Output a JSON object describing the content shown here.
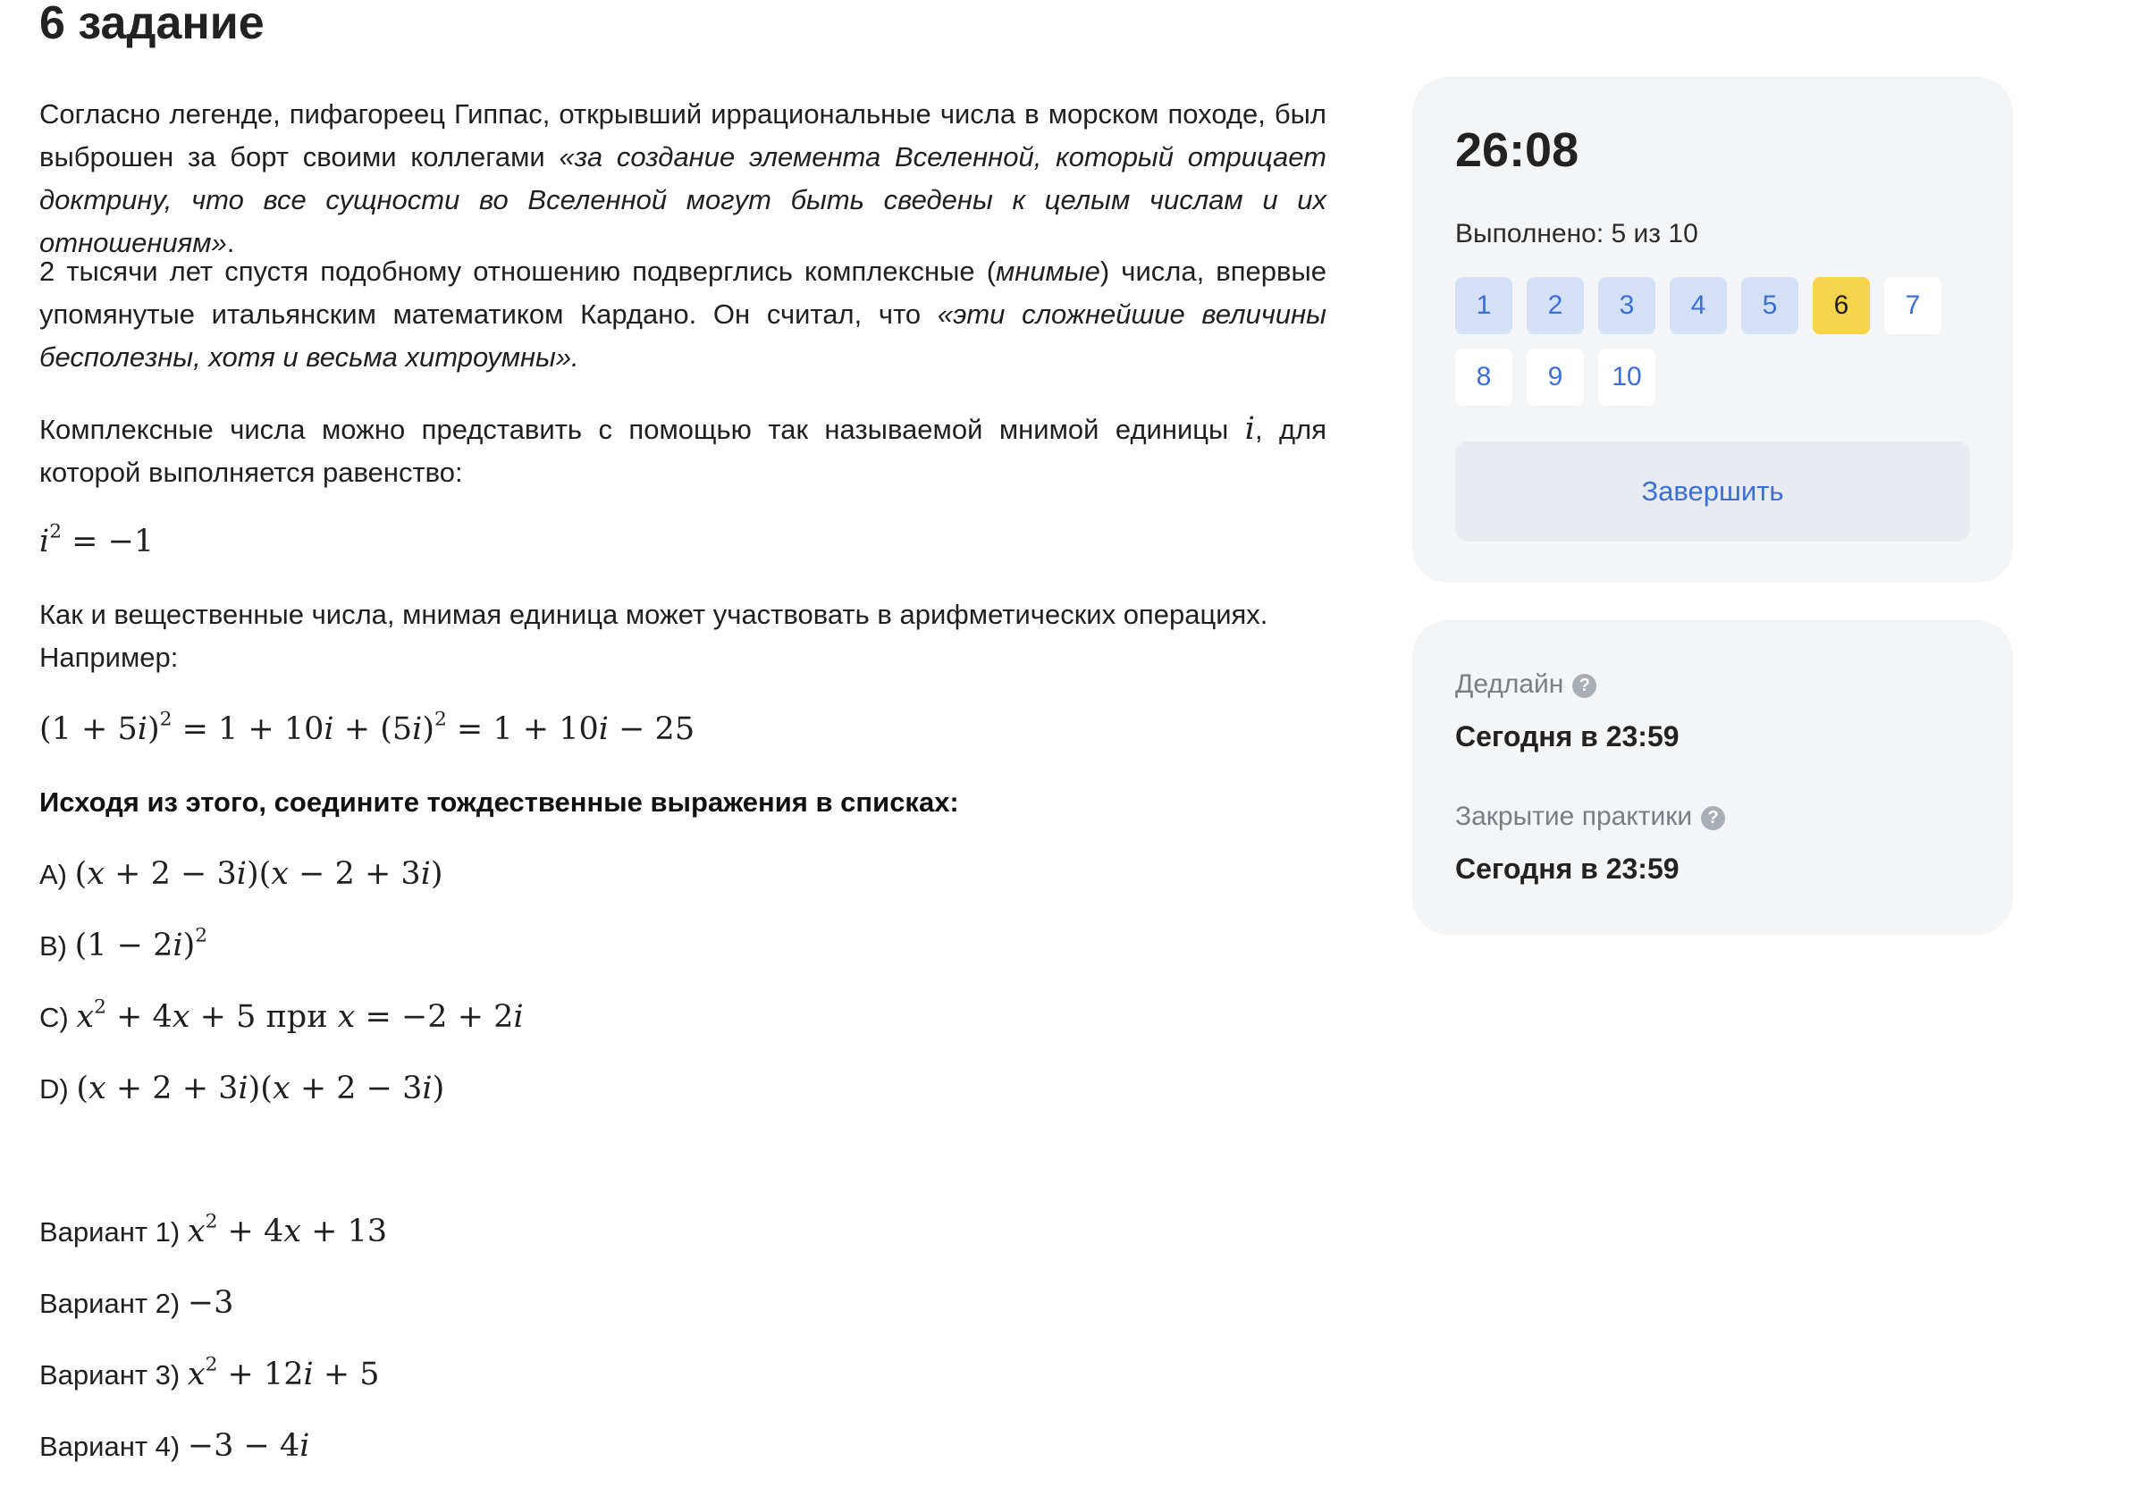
{
  "task": {
    "title": "6 задание",
    "intro1": [
      {
        "text": "Согласно легенде, пифагореец Гиппас, открывший иррациональные числа в морском походе, был выброшен за борт своими коллегами ",
        "style": "normal"
      },
      {
        "text": "«за создание элемента Вселенной, который отрицает доктрину, что все сущности во Вселенной могут быть сведены к целым числам и их отношениям»",
        "style": "italic"
      },
      {
        "text": ".",
        "style": "normal"
      }
    ],
    "intro2": [
      {
        "text": "2 тысячи лет спустя подобному отношению подверглись комплексные (",
        "style": "normal"
      },
      {
        "text": "мнимые",
        "style": "italic"
      },
      {
        "text": ") числа, впервые упомянутые итальянским математиком Кардано. Он считал, что ",
        "style": "normal"
      },
      {
        "text": "«эти сложнейшие величины бесполезны, хотя и весьма хитроумны».",
        "style": "italic"
      }
    ],
    "intro3": [
      {
        "text": "Комплексные числа можно представить с помощью так называемой мнимой единицы ",
        "style": "normal"
      },
      {
        "text": "i",
        "style": "mathvar"
      },
      {
        "text": ", для которой выполняется равенство:",
        "style": "normal"
      }
    ],
    "equation1": [
      {
        "text": "i",
        "style": "var"
      },
      {
        "text": "2",
        "style": "sup"
      },
      {
        "text": " = −1",
        "style": "normal"
      }
    ],
    "intro4": [
      {
        "text": "Как и вещественные числа, мнимая единица может участвовать в арифметических операциях.",
        "style": "normal"
      },
      {
        "text": "",
        "style": "br"
      },
      {
        "text": "Например:",
        "style": "normal"
      }
    ],
    "equation2": [
      {
        "text": "(1 + 5",
        "style": "normal"
      },
      {
        "text": "i",
        "style": "var"
      },
      {
        "text": ")",
        "style": "normal"
      },
      {
        "text": "2",
        "style": "sup"
      },
      {
        "text": " = 1 + 10",
        "style": "normal"
      },
      {
        "text": "i",
        "style": "var"
      },
      {
        "text": " + (5",
        "style": "normal"
      },
      {
        "text": "i",
        "style": "var"
      },
      {
        "text": ")",
        "style": "normal"
      },
      {
        "text": "2",
        "style": "sup"
      },
      {
        "text": " = 1 + 10",
        "style": "normal"
      },
      {
        "text": "i",
        "style": "var"
      },
      {
        "text": " − 25",
        "style": "normal"
      }
    ],
    "instruction": "Исходя из этого, соедините тождественные выражения в списках:",
    "left_items": [
      {
        "label": "A) ",
        "expr": [
          {
            "text": "(",
            "style": "normal"
          },
          {
            "text": "x",
            "style": "var"
          },
          {
            "text": " + 2 − 3",
            "style": "normal"
          },
          {
            "text": "i",
            "style": "var"
          },
          {
            "text": ")(",
            "style": "normal"
          },
          {
            "text": "x",
            "style": "var"
          },
          {
            "text": " − 2 + 3",
            "style": "normal"
          },
          {
            "text": "i",
            "style": "var"
          },
          {
            "text": ")",
            "style": "normal"
          }
        ]
      },
      {
        "label": "B) ",
        "expr": [
          {
            "text": "(1 − 2",
            "style": "normal"
          },
          {
            "text": "i",
            "style": "var"
          },
          {
            "text": ")",
            "style": "normal"
          },
          {
            "text": "2",
            "style": "sup"
          }
        ]
      },
      {
        "label": "C) ",
        "expr": [
          {
            "text": "x",
            "style": "var"
          },
          {
            "text": "2",
            "style": "sup"
          },
          {
            "text": " + 4",
            "style": "normal"
          },
          {
            "text": "x",
            "style": "var"
          },
          {
            "text": " + 5 при ",
            "style": "normal"
          },
          {
            "text": "x",
            "style": "var"
          },
          {
            "text": " = −2 + 2",
            "style": "normal"
          },
          {
            "text": "i",
            "style": "var"
          }
        ]
      },
      {
        "label": "D) ",
        "expr": [
          {
            "text": "(",
            "style": "normal"
          },
          {
            "text": "x",
            "style": "var"
          },
          {
            "text": " + 2 + 3",
            "style": "normal"
          },
          {
            "text": "i",
            "style": "var"
          },
          {
            "text": ")(",
            "style": "normal"
          },
          {
            "text": "x",
            "style": "var"
          },
          {
            "text": " + 2 − 3",
            "style": "normal"
          },
          {
            "text": "i",
            "style": "var"
          },
          {
            "text": ")",
            "style": "normal"
          }
        ]
      }
    ],
    "right_items": [
      {
        "label": "Вариант 1) ",
        "expr": [
          {
            "text": "x",
            "style": "var"
          },
          {
            "text": "2",
            "style": "sup"
          },
          {
            "text": " + 4",
            "style": "normal"
          },
          {
            "text": "x",
            "style": "var"
          },
          {
            "text": " + 13",
            "style": "normal"
          }
        ]
      },
      {
        "label": "Вариант 2) ",
        "expr": [
          {
            "text": "−3",
            "style": "normal"
          }
        ]
      },
      {
        "label": "Вариант 3) ",
        "expr": [
          {
            "text": "x",
            "style": "var"
          },
          {
            "text": "2",
            "style": "sup"
          },
          {
            "text": " + 12",
            "style": "normal"
          },
          {
            "text": "i",
            "style": "var"
          },
          {
            "text": " + 5",
            "style": "normal"
          }
        ]
      },
      {
        "label": "Вариант 4) ",
        "expr": [
          {
            "text": "−3 − 4",
            "style": "normal"
          },
          {
            "text": "i",
            "style": "var"
          }
        ]
      }
    ]
  },
  "sidebar": {
    "timer": "26:08",
    "progress": "Выполнено: 5 из 10",
    "questions": [
      {
        "label": "1",
        "state": "done"
      },
      {
        "label": "2",
        "state": "done"
      },
      {
        "label": "3",
        "state": "done"
      },
      {
        "label": "4",
        "state": "done"
      },
      {
        "label": "5",
        "state": "done"
      },
      {
        "label": "6",
        "state": "current"
      },
      {
        "label": "7",
        "state": "todo"
      },
      {
        "label": "8",
        "state": "todo"
      },
      {
        "label": "9",
        "state": "todo"
      },
      {
        "label": "10",
        "state": "todo"
      }
    ],
    "finish_label": "Завершить",
    "deadline_label": "Дедлайн",
    "deadline_value": "Сегодня в 23:59",
    "closing_label": "Закрытие практики",
    "closing_value": "Сегодня в 23:59",
    "help_icon_glyph": "?"
  },
  "colors": {
    "accent": "#3a6fd8",
    "done_bg": "#d3e0f6",
    "current_bg": "#f7d44c",
    "card_bg": "#f4f5f7"
  }
}
